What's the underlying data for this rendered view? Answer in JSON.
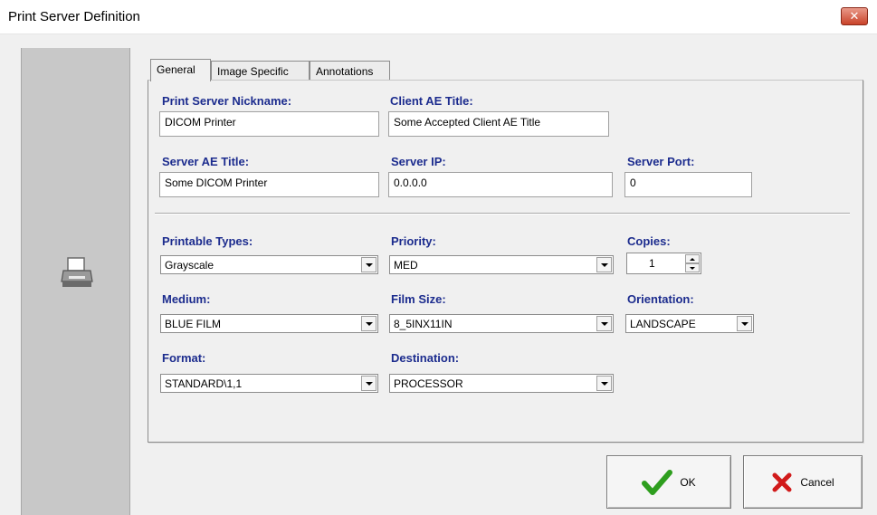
{
  "window": {
    "title": "Print Server Definition",
    "close_glyph": "✕"
  },
  "tabs": [
    {
      "label": "General"
    },
    {
      "label": "Image Specific"
    },
    {
      "label": "Annotations"
    }
  ],
  "form": {
    "nickname": {
      "label": "Print Server Nickname:",
      "value": "DICOM Printer"
    },
    "client_ae": {
      "label": "Client AE Title:",
      "value": "Some Accepted Client AE Title"
    },
    "server_ae": {
      "label": "Server AE Title:",
      "value": "Some DICOM Printer"
    },
    "server_ip": {
      "label": "Server IP:",
      "value": "0.0.0.0"
    },
    "server_port": {
      "label": "Server Port:",
      "value": "0"
    },
    "printable_types": {
      "label": "Printable Types:",
      "value": "Grayscale"
    },
    "priority": {
      "label": "Priority:",
      "value": "MED"
    },
    "copies": {
      "label": "Copies:",
      "value": "1"
    },
    "medium": {
      "label": "Medium:",
      "value": "BLUE FILM"
    },
    "film_size": {
      "label": "Film Size:",
      "value": "8_5INX11IN"
    },
    "orientation": {
      "label": "Orientation:",
      "value": "LANDSCAPE"
    },
    "format": {
      "label": "Format:",
      "value": "STANDARD\\1,1"
    },
    "destination": {
      "label": "Destination:",
      "value": "PROCESSOR"
    }
  },
  "buttons": {
    "ok": "OK",
    "cancel": "Cancel"
  },
  "icons": {
    "sidebar": "printer-icon",
    "ok": "checkmark-icon",
    "cancel": "red-x-icon"
  },
  "colors": {
    "label": "#1c2c8e",
    "sidebar": "#c8c8c8",
    "ok_check": "#2e9e1e",
    "cancel_x": "#d11a1a"
  }
}
